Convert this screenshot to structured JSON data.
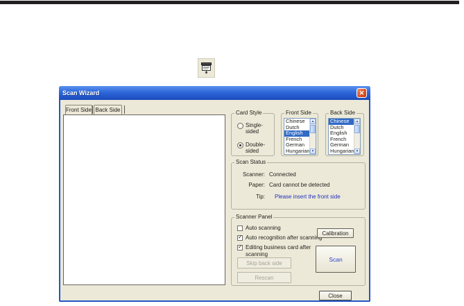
{
  "icons": {
    "close": "✕",
    "check": "✓",
    "arrow_up": "▲",
    "arrow_down": "▼"
  },
  "dialog": {
    "title": "Scan Wizard",
    "tabs": [
      "Front Side",
      "Back Side"
    ],
    "card_style": {
      "legend": "Card Style",
      "options": [
        {
          "label": "Single-sided",
          "selected": false
        },
        {
          "label": "Double-sided",
          "selected": true
        }
      ]
    },
    "front_side": {
      "legend": "Front Side",
      "items": [
        "Chinese",
        "Dutch",
        "English",
        "French",
        "German",
        "Hungarian"
      ],
      "selected": "English"
    },
    "back_side": {
      "legend": "Back Side",
      "items": [
        "Chinese",
        "Dutch",
        "English",
        "French",
        "German",
        "Hungarian"
      ],
      "selected": "Chinese"
    },
    "scan_status": {
      "legend": "Scan Status",
      "rows": [
        {
          "label": "Scanner:",
          "value": "Connected"
        },
        {
          "label": "Paper:",
          "value": "Card cannot be detected"
        },
        {
          "label": "Tip:",
          "value": "Please insert the front side"
        }
      ]
    },
    "scanner_panel": {
      "legend": "Scanner Panel",
      "checkboxes": [
        {
          "label": "Auto scanning",
          "checked": false
        },
        {
          "label": "Auto recognition after scanning",
          "checked": true
        },
        {
          "label": "Editing business card after scanning",
          "checked": true
        }
      ],
      "calibration_label": "Calibration",
      "skip_back_label": "Skip back side",
      "rescan_label": "Rescan",
      "scan_label": "Scan"
    },
    "close_label": "Close"
  },
  "colors": {
    "titlebar_blue": "#2a63d5",
    "window_border": "#2456c5",
    "dialog_bg": "#ece9d8",
    "selection_blue": "#316ac5",
    "tip_text_blue": "#2233bb",
    "scan_text_blue": "#2743c6"
  }
}
